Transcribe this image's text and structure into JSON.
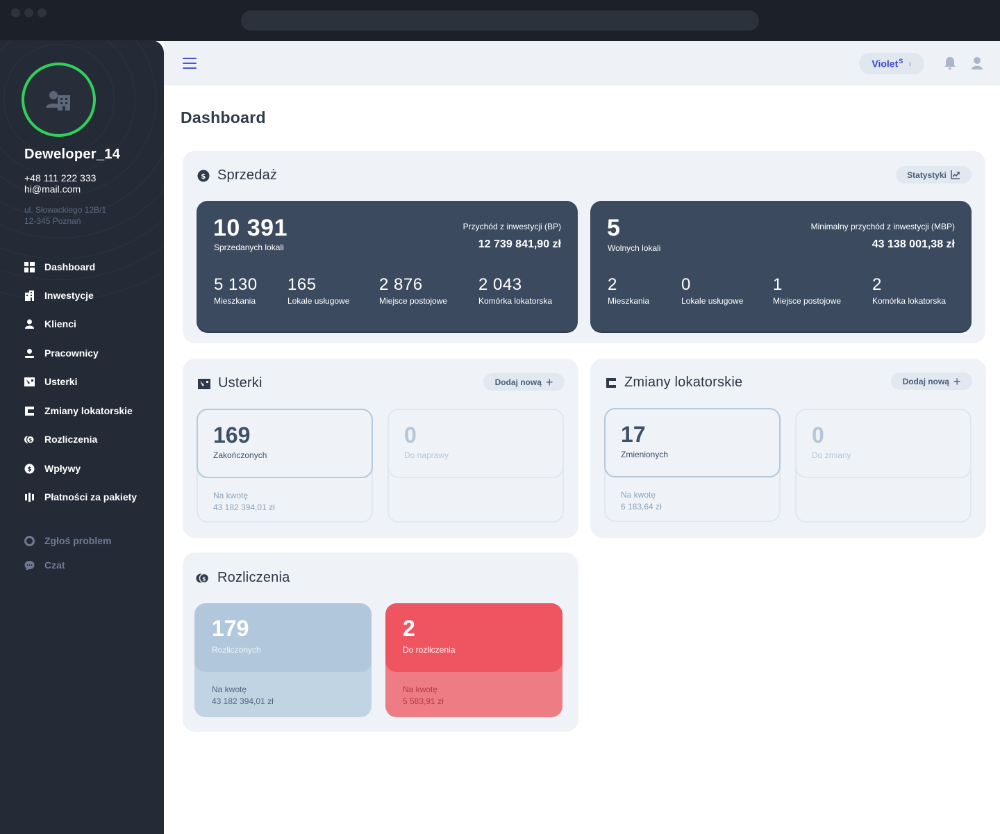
{
  "user": {
    "name": "Deweloper_14",
    "phone": "+48 111 222 333",
    "email": "hi@mail.com",
    "address_line1": "ul. Słowackiego 12B/1",
    "address_line2": "12-345 Poznań"
  },
  "nav": {
    "items": [
      {
        "label": "Dashboard",
        "icon": "grid-icon"
      },
      {
        "label": "Inwestycje",
        "icon": "building-icon"
      },
      {
        "label": "Klienci",
        "icon": "person-icon"
      },
      {
        "label": "Pracownicy",
        "icon": "worker-icon"
      },
      {
        "label": "Usterki",
        "icon": "fault-icon"
      },
      {
        "label": "Zmiany lokatorskie",
        "icon": "changes-icon"
      },
      {
        "label": "Rozliczenia",
        "icon": "coins-icon"
      },
      {
        "label": "Wpływy",
        "icon": "dollar-icon"
      },
      {
        "label": "Płatności za pakiety",
        "icon": "bars-icon"
      }
    ],
    "secondary": [
      {
        "label": "Zgłoś problem",
        "icon": "lifebuoy-icon"
      },
      {
        "label": "Czat",
        "icon": "chat-icon"
      }
    ]
  },
  "topbar": {
    "plan_name": "Violet",
    "plan_badge": "S"
  },
  "page": {
    "title": "Dashboard"
  },
  "sales": {
    "title": "Sprzedaż",
    "stats_button": "Statystyki",
    "sold": {
      "count": "10 391",
      "label": "Sprzedanych lokali",
      "revenue_label": "Przychód z inwestycji (BP)",
      "revenue_value": "12 739 841,90 zł",
      "breakdown": [
        {
          "value": "5 130",
          "label": "Mieszkania"
        },
        {
          "value": "165",
          "label": "Lokale usługowe"
        },
        {
          "value": "2 876",
          "label": "Miejsce postojowe"
        },
        {
          "value": "2 043",
          "label": "Komórka lokatorska"
        }
      ]
    },
    "free": {
      "count": "5",
      "label": "Wolnych lokali",
      "revenue_label": "Minimalny przychód z inwestycji (MBP)",
      "revenue_value": "43 138 001,38 zł",
      "breakdown": [
        {
          "value": "2",
          "label": "Mieszkania"
        },
        {
          "value": "0",
          "label": "Lokale usługowe"
        },
        {
          "value": "1",
          "label": "Miejsce postojowe"
        },
        {
          "value": "2",
          "label": "Komórka lokatorska"
        }
      ]
    }
  },
  "faults": {
    "title": "Usterki",
    "add_button": "Dodaj nową",
    "done": {
      "count": "169",
      "label": "Zakończonych",
      "amount_label": "Na kwotę",
      "amount": "43 182 394,01 zł"
    },
    "todo": {
      "count": "0",
      "label": "Do naprawy"
    }
  },
  "changes": {
    "title": "Zmiany lokatorskie",
    "add_button": "Dodaj nową",
    "done": {
      "count": "17",
      "label": "Zmienionych",
      "amount_label": "Na kwotę",
      "amount": "6 183,64 zł"
    },
    "todo": {
      "count": "0",
      "label": "Do zmiany"
    }
  },
  "settlements": {
    "title": "Rozliczenia",
    "settled": {
      "count": "179",
      "label": "Rozliczonych",
      "amount_label": "Na kwotę",
      "amount": "43 182 394,01 zł"
    },
    "pending": {
      "count": "2",
      "label": "Do rozliczenia",
      "amount_label": "Na kwotę",
      "amount": "5 583,91 zł"
    }
  },
  "colors": {
    "accent": "#3646c8",
    "avatar_ring": "#2fd15a",
    "sidebar_bg": "#252b36",
    "dark_card": "#3b4a5f",
    "settled_card": "#b3c9dc",
    "pending_card": "#ee5561"
  }
}
